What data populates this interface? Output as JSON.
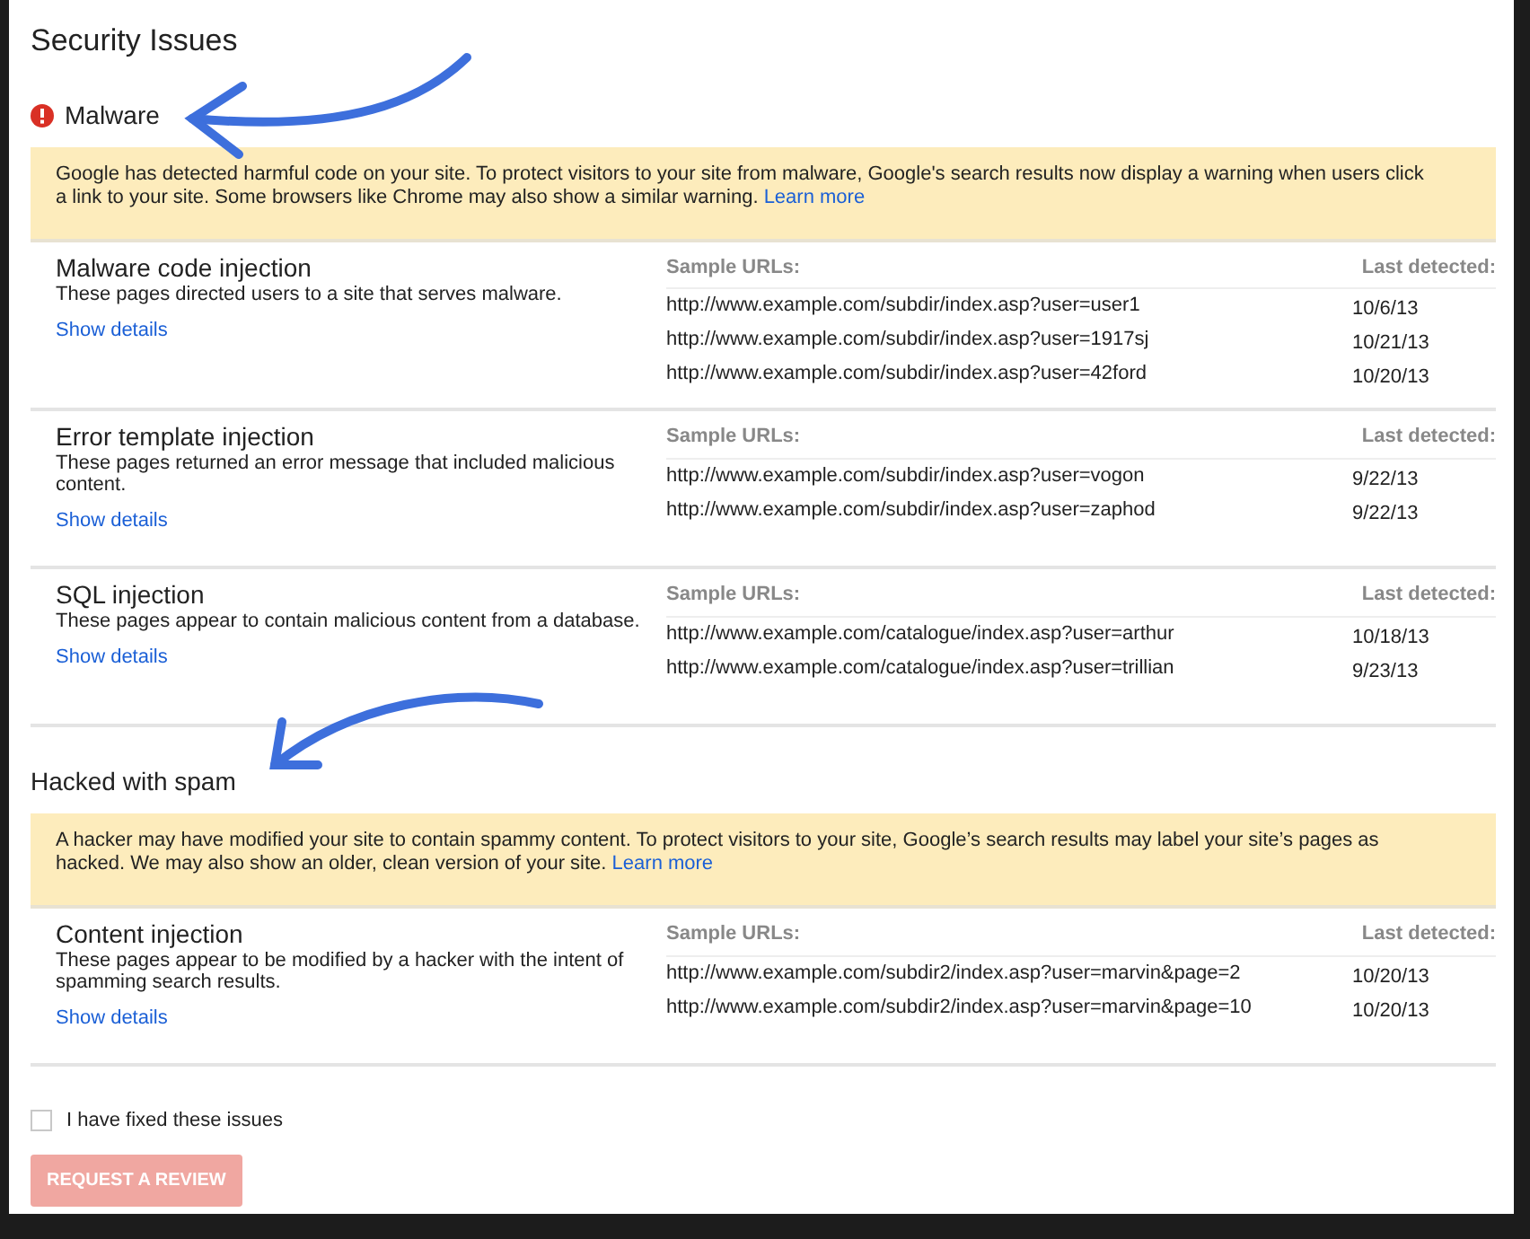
{
  "title": "Security Issues",
  "groups": [
    {
      "heading": "Malware",
      "kind": "error",
      "notice": "Google has detected harmful code on your site. To protect visitors to your site from malware, Google's search results now display a warning when users click a link to your site. Some browsers like Chrome may also show a similar warning.",
      "learn_more": "Learn more",
      "issues": [
        {
          "name": "Malware code injection",
          "description": "These pages directed users to a site that serves malware.",
          "details_link": "Show details",
          "url_header": "Sample URLs:",
          "date_header": "Last detected:",
          "samples": [
            {
              "url": "http://www.example.com/subdir/index.asp?user=user1",
              "date": "10/6/13"
            },
            {
              "url": "http://www.example.com/subdir/index.asp?user=1917sj",
              "date": "10/21/13"
            },
            {
              "url": "http://www.example.com/subdir/index.asp?user=42ford",
              "date": "10/20/13"
            }
          ]
        },
        {
          "name": "Error template injection",
          "description": "These pages returned an error message that included malicious content.",
          "details_link": "Show details",
          "url_header": "Sample URLs:",
          "date_header": "Last detected:",
          "samples": [
            {
              "url": "http://www.example.com/subdir/index.asp?user=vogon",
              "date": "9/22/13"
            },
            {
              "url": "http://www.example.com/subdir/index.asp?user=zaphod",
              "date": "9/22/13"
            }
          ]
        },
        {
          "name": "SQL injection",
          "description": "These pages appear to contain malicious content from a database.",
          "details_link": "Show details",
          "url_header": "Sample URLs:",
          "date_header": "Last detected:",
          "samples": [
            {
              "url": "http://www.example.com/catalogue/index.asp?user=arthur",
              "date": "10/18/13"
            },
            {
              "url": "http://www.example.com/catalogue/index.asp?user=trillian",
              "date": "9/23/13"
            }
          ]
        }
      ]
    },
    {
      "heading": "Hacked with spam",
      "kind": "plain",
      "notice": "A hacker may have modified your site to contain spammy content. To protect visitors to your site, Google’s search results may label your site’s pages as hacked. We may also show an older, clean version of your site.",
      "learn_more": "Learn more",
      "issues": [
        {
          "name": "Content injection",
          "description": "These pages appear to be modified by a hacker with the intent of spamming search results.",
          "details_link": "Show details",
          "url_header": "Sample URLs:",
          "date_header": "Last detected:",
          "samples": [
            {
              "url": "http://www.example.com/subdir2/index.asp?user=marvin&page=2",
              "date": "10/20/13"
            },
            {
              "url": "http://www.example.com/subdir2/index.asp?user=marvin&page=10",
              "date": "10/20/13"
            }
          ]
        }
      ]
    }
  ],
  "fixed_checkbox": {
    "label": "I have fixed these issues",
    "checked": false
  },
  "review_button": {
    "label": "REQUEST A REVIEW",
    "disabled": true
  }
}
